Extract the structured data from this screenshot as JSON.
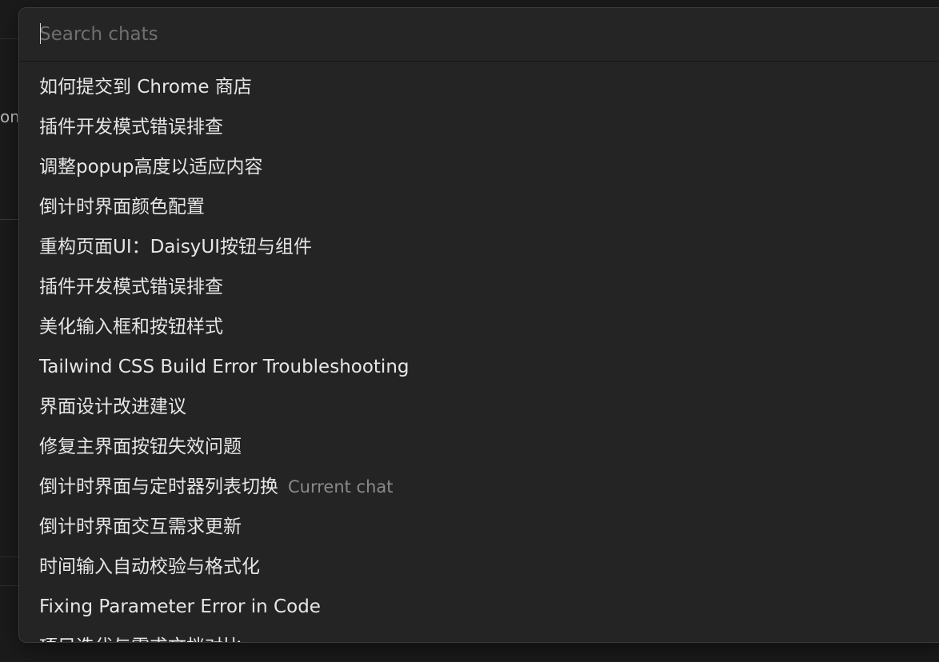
{
  "background": {
    "fragment_text": "om"
  },
  "search": {
    "placeholder": "Search chats",
    "value": ""
  },
  "chats": [
    {
      "title": "如何提交到 Chrome 商店",
      "meta": ""
    },
    {
      "title": "插件开发模式错误排查",
      "meta": ""
    },
    {
      "title": "调整popup高度以适应内容",
      "meta": ""
    },
    {
      "title": "倒计时界面颜色配置",
      "meta": ""
    },
    {
      "title": "重构页面UI：DaisyUI按钮与组件",
      "meta": ""
    },
    {
      "title": "插件开发模式错误排查",
      "meta": ""
    },
    {
      "title": "美化输入框和按钮样式",
      "meta": ""
    },
    {
      "title": "Tailwind CSS Build Error Troubleshooting",
      "meta": ""
    },
    {
      "title": "界面设计改进建议",
      "meta": ""
    },
    {
      "title": "修复主界面按钮失效问题",
      "meta": ""
    },
    {
      "title": "倒计时界面与定时器列表切换",
      "meta": "Current chat"
    },
    {
      "title": "倒计时界面交互需求更新",
      "meta": ""
    },
    {
      "title": "时间输入自动校验与格式化",
      "meta": ""
    },
    {
      "title": "Fixing Parameter Error in Code",
      "meta": ""
    },
    {
      "title": "项目迭代与需求文档对比",
      "meta": ""
    }
  ],
  "colors": {
    "panel_bg": "#242424",
    "text_primary": "#e6e6e6",
    "text_secondary": "#8a8a8a",
    "placeholder": "#6f6f6f"
  }
}
